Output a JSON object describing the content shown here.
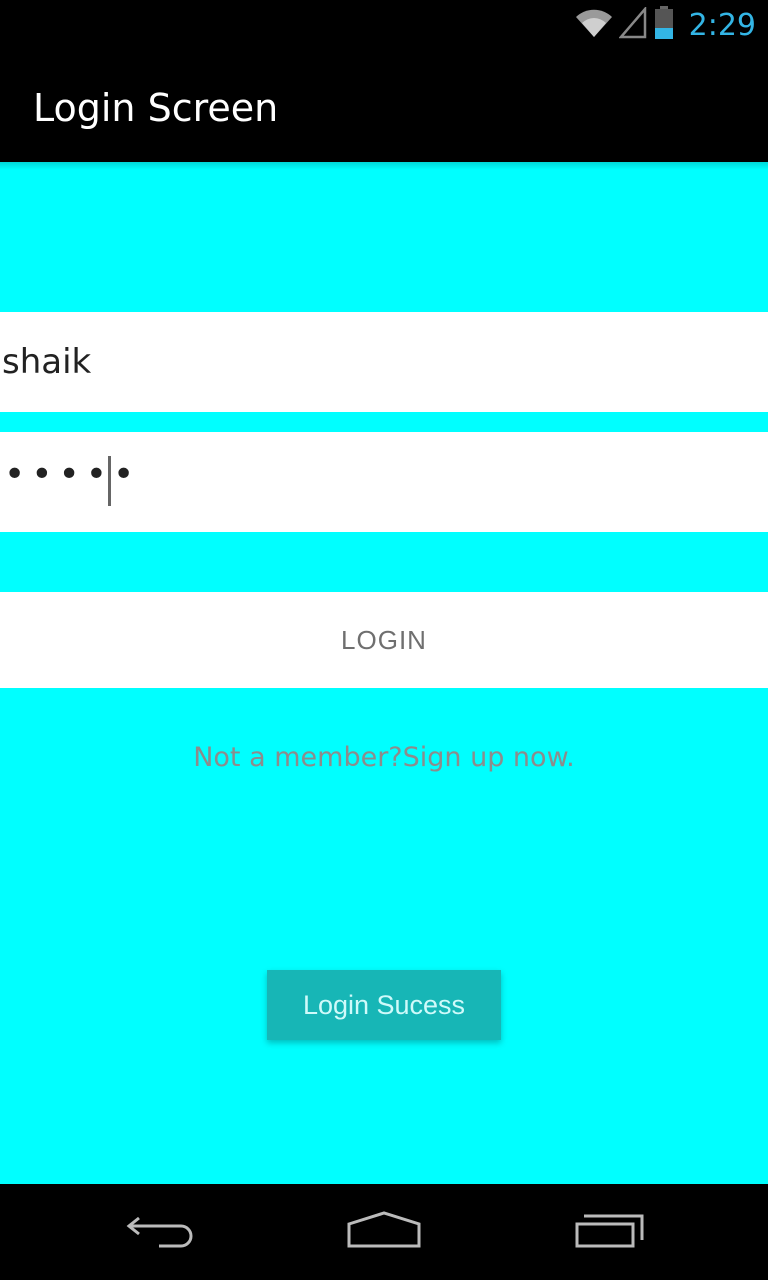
{
  "status_bar": {
    "time": "2:29",
    "icons": [
      "wifi-icon",
      "signal-icon",
      "battery-icon"
    ],
    "time_color": "#33b5e5"
  },
  "action_bar": {
    "title": "Login Screen"
  },
  "form": {
    "username_value": "shaik",
    "password_mask": "•••••",
    "login_label": "LOGIN",
    "signup_text": "Not a member?Sign up now.",
    "success_label": "Login Sucess"
  },
  "nav_bar": {
    "icons": [
      "back-icon",
      "home-icon",
      "recents-icon"
    ]
  },
  "colors": {
    "background": "#00ffff",
    "success_button": "#17b6b6",
    "action_bar": "#000000"
  }
}
